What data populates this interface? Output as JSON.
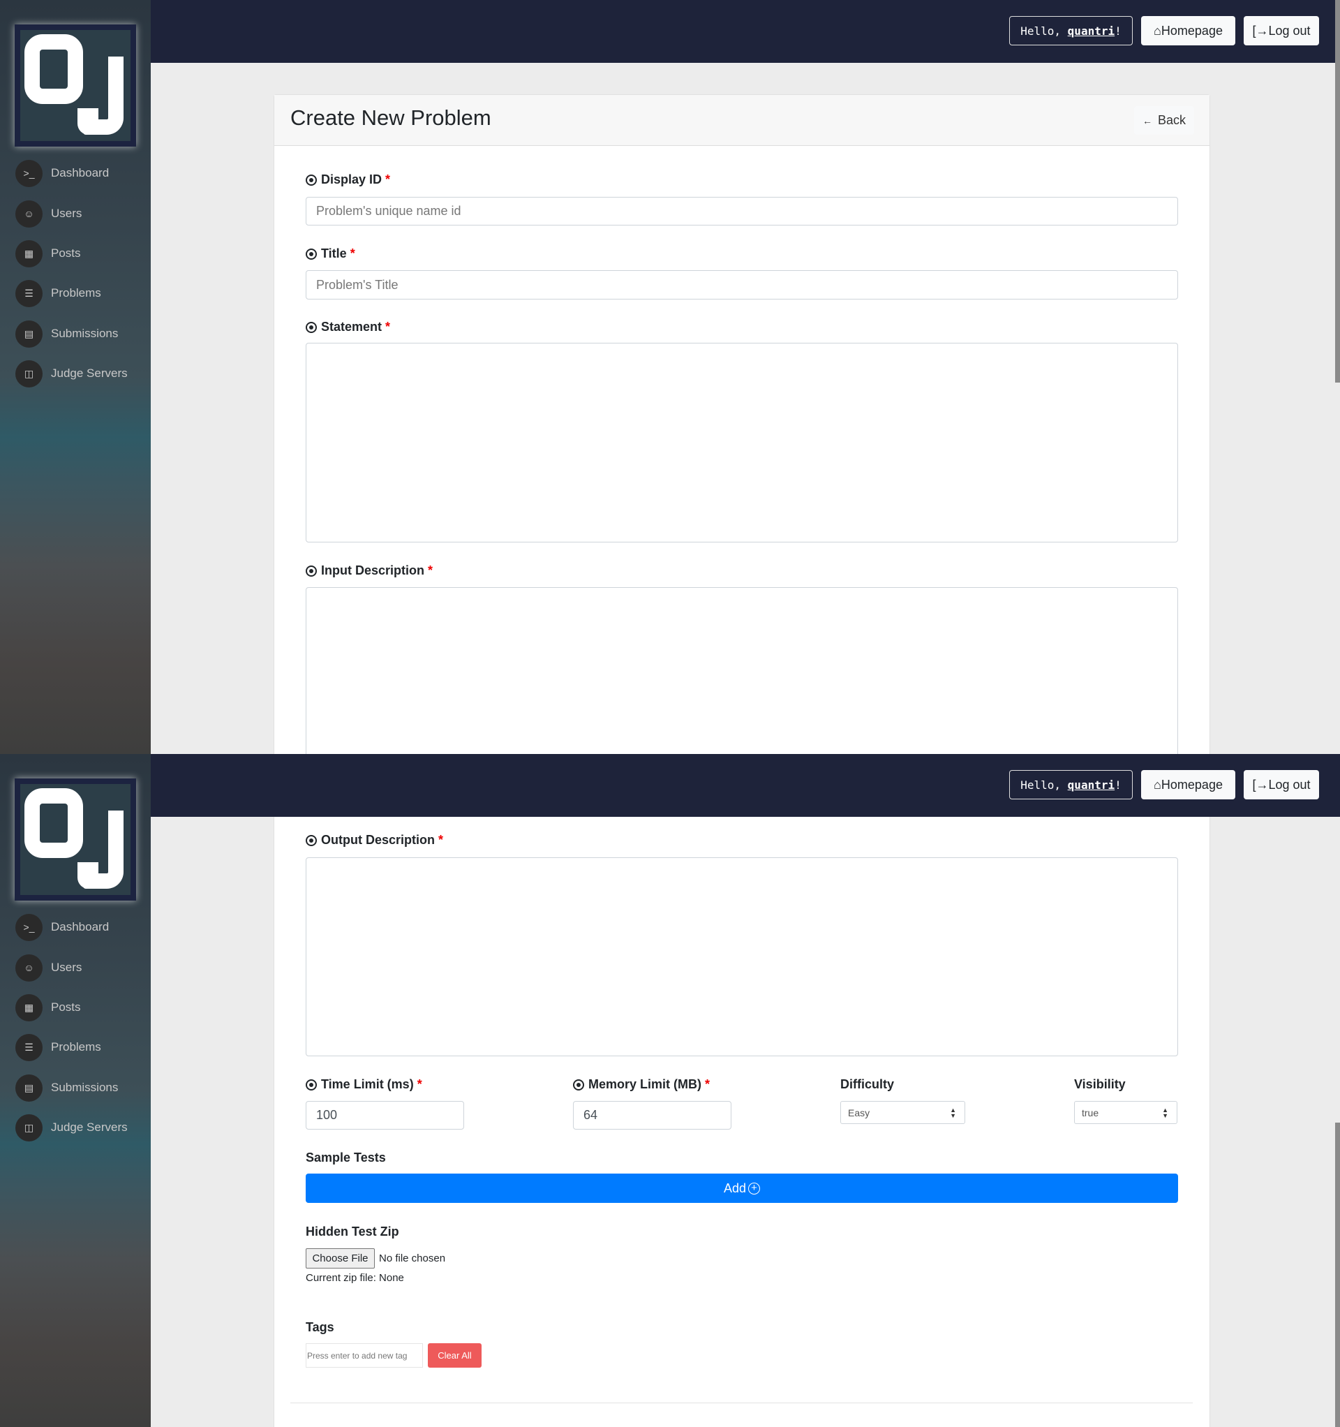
{
  "sidebar": {
    "logo_text": "OJ",
    "items": [
      {
        "label": "Dashboard",
        "icon": "terminal-icon"
      },
      {
        "label": "Users",
        "icon": "user-icon"
      },
      {
        "label": "Posts",
        "icon": "grid-icon"
      },
      {
        "label": "Problems",
        "icon": "list-icon"
      },
      {
        "label": "Submissions",
        "icon": "document-icon"
      },
      {
        "label": "Judge Servers",
        "icon": "server-icon"
      }
    ]
  },
  "header": {
    "greeting_prefix": "Hello, ",
    "username": "quantri",
    "greeting_suffix": "!",
    "homepage_label": "Homepage",
    "logout_label": "Log out"
  },
  "page": {
    "title": "Create New Problem",
    "back_label": "Back"
  },
  "form": {
    "display_id": {
      "label": "Display ID",
      "placeholder": "Problem's unique name id"
    },
    "title": {
      "label": "Title",
      "placeholder": "Problem's Title"
    },
    "statement": {
      "label": "Statement"
    },
    "input_description": {
      "label": "Input Description"
    },
    "output_description": {
      "label": "Output Description"
    },
    "time_limit": {
      "label": "Time Limit (ms)",
      "value": "100"
    },
    "memory_limit": {
      "label": "Memory Limit (MB)",
      "value": "64"
    },
    "difficulty": {
      "label": "Difficulty",
      "value": "Easy"
    },
    "visibility": {
      "label": "Visibility",
      "value": "true"
    },
    "sample_tests": {
      "label": "Sample Tests",
      "add_label": "Add"
    },
    "hidden_test_zip": {
      "label": "Hidden Test Zip",
      "choose_label": "Choose File",
      "file_status": "No file chosen",
      "current_file": "Current zip file: None"
    },
    "tags": {
      "label": "Tags",
      "placeholder": "Press enter to add new tag",
      "clear_label": "Clear All"
    },
    "required_mark": "*"
  },
  "colors": {
    "header": "#1e233a",
    "primary": "#007bff",
    "danger": "#ee5a5a",
    "required": "#ee0000"
  }
}
